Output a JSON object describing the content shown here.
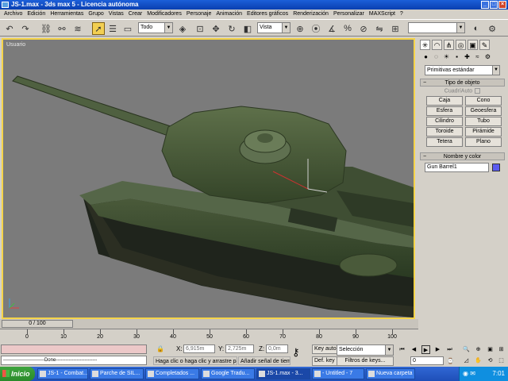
{
  "window": {
    "title": "JS-1.max - 3ds max 5 - Licencia autónoma"
  },
  "menu": [
    "Archivo",
    "Edición",
    "Herramientas",
    "Grupo",
    "Vistas",
    "Crear",
    "Modificadores",
    "Personaje",
    "Animación",
    "Editores gráficos",
    "Renderización",
    "Personalizar",
    "MAXScript",
    "?"
  ],
  "toolbar": {
    "selection_filter": "Todo",
    "ref_coord": "Vista",
    "named_selection": ""
  },
  "viewport": {
    "label": "Usuario"
  },
  "command_panel": {
    "category": "Primitivas estándar",
    "rollout_object_type": "Tipo de objeto",
    "autogrid": "CuadríAuto",
    "buttons": [
      "Caja",
      "Cono",
      "Esfera",
      "Geoesfera",
      "Cilindro",
      "Tubo",
      "Toroide",
      "Pirámide",
      "Tetera",
      "Plano"
    ],
    "rollout_name_color": "Nombre y color",
    "object_name": "Gun Barrel1",
    "object_color": "#5b5bf0"
  },
  "time": {
    "slider": "0 / 100",
    "ticks": [
      "0",
      "10",
      "20",
      "30",
      "40",
      "50",
      "60",
      "70",
      "80",
      "90",
      "100"
    ]
  },
  "status": {
    "maxscript_output": "--------------------------Done--------------------------",
    "x_label": "X:",
    "x_value": "6,915m",
    "y_label": "Y:",
    "y_value": "2,725m",
    "z_label": "Z:",
    "z_value": "0,0m",
    "prompt_hint": "Haga clic o haga clic y arrastre par",
    "time_tag": "Añadir señal de tiem",
    "key_auto": "Key auto",
    "def_key": "Def. key",
    "key_filter_sel": "Selección",
    "key_filters": "Filtros de keys...",
    "frame": "0"
  },
  "taskbar": {
    "start": "Inicio",
    "tasks": [
      "JS-1 - Combat...",
      "Parche de SIL...",
      "Completados ...",
      "Google Tradu...",
      "JS-1.max - 3...",
      "- Untitled - 7",
      "Nueva carpeta"
    ],
    "clock": "7:01"
  }
}
